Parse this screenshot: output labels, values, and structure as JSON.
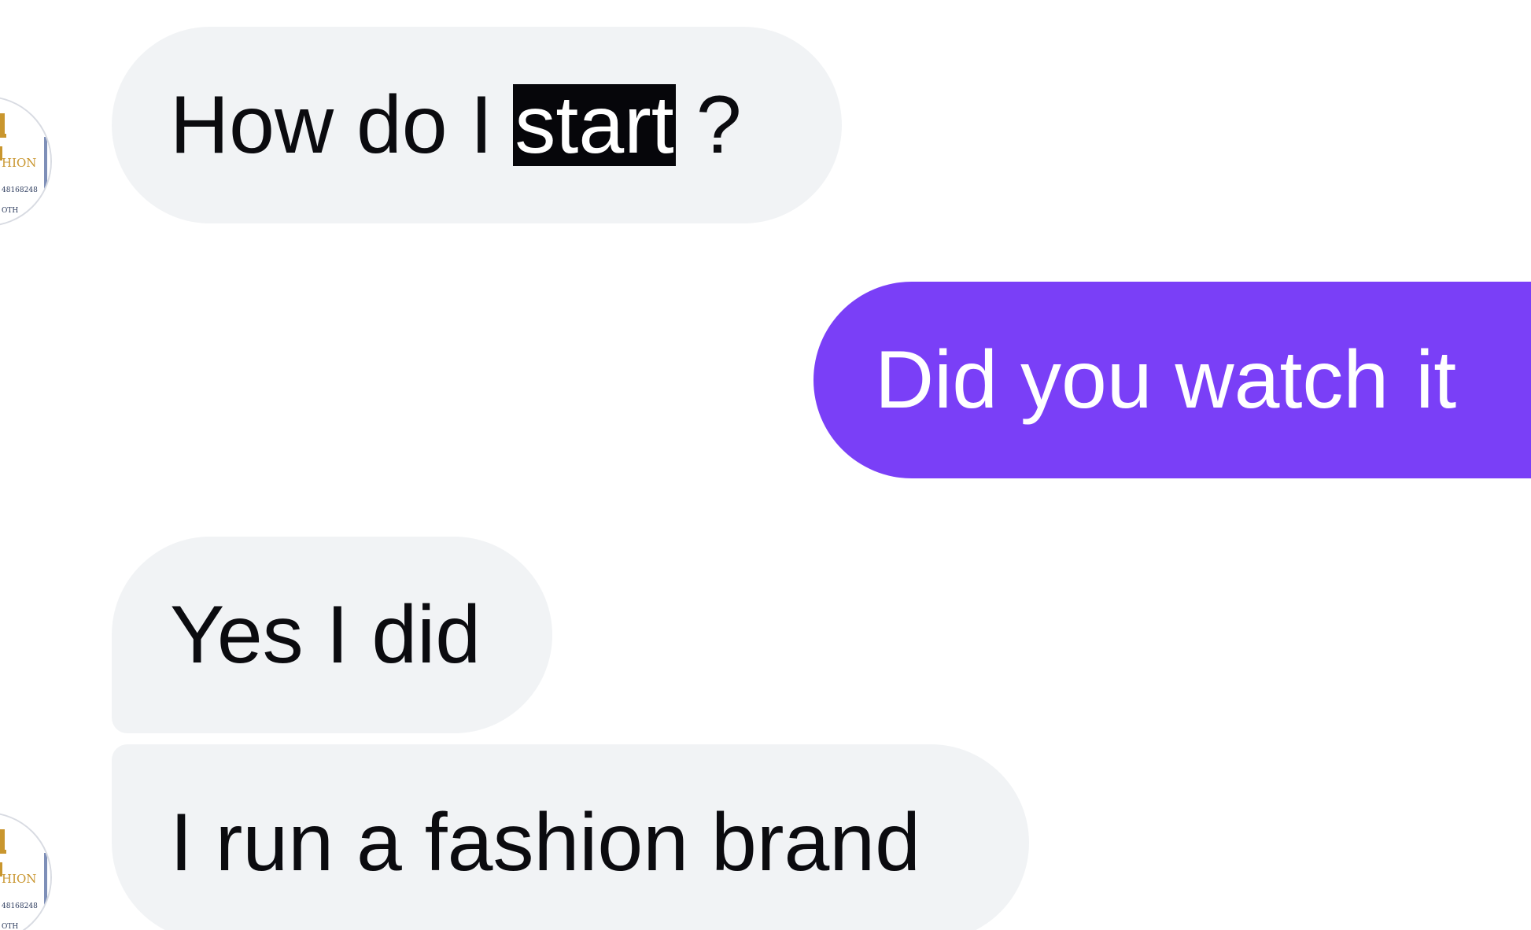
{
  "conversation": {
    "messages": [
      {
        "sender": "contact",
        "pre": "How do I",
        "highlight": "start",
        "post": "?"
      },
      {
        "sender": "me",
        "word1": "Did you watch",
        "word2": "it"
      },
      {
        "sender": "contact",
        "text": "Yes I did"
      },
      {
        "sender": "contact",
        "text": "I run a fashion brand"
      }
    ],
    "avatar": {
      "line1": "HION",
      "line2": "48168248",
      "line3": "OTH"
    }
  },
  "colors": {
    "incoming_bubble": "#f1f3f5",
    "outgoing_bubble": "#7a3ff7",
    "selection_highlight": "#06060a"
  },
  "icons": {
    "avatar": "brand-logo-avatar"
  }
}
